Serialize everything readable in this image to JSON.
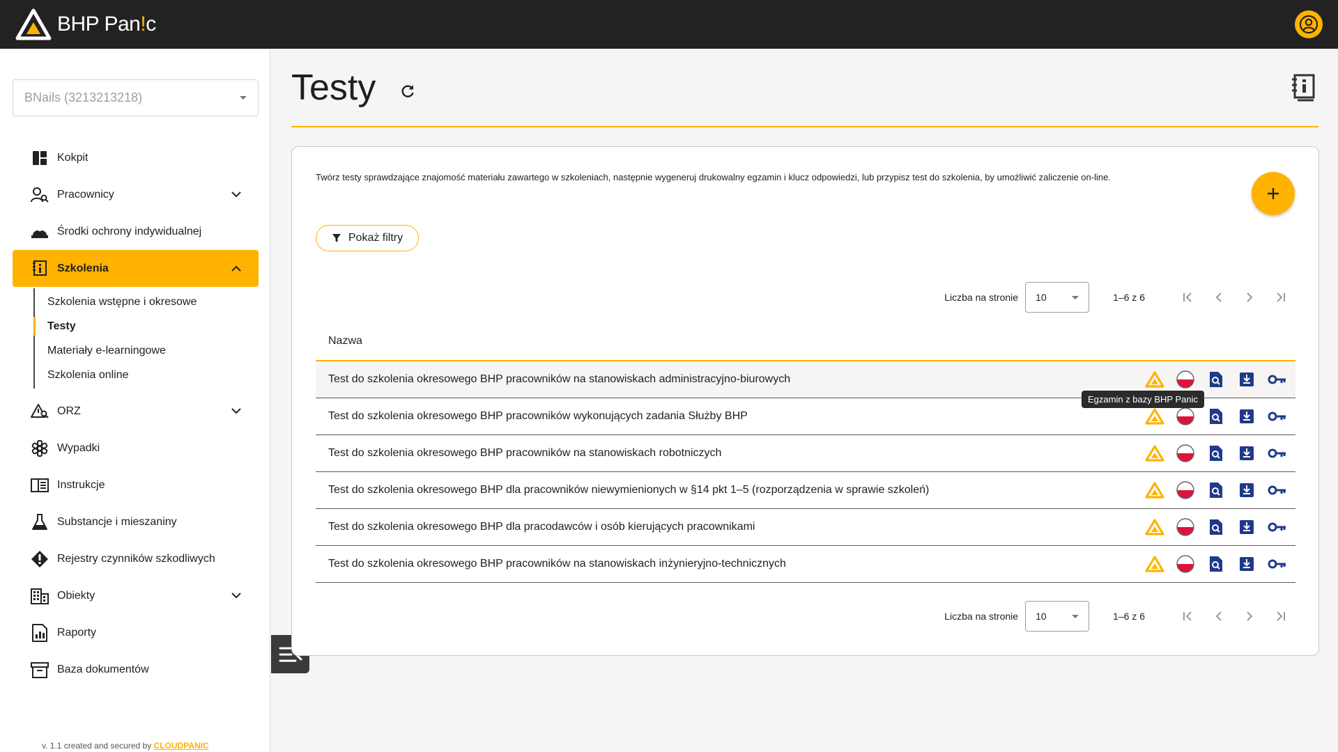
{
  "app": {
    "name_prefix": "BHP Pan",
    "name_dot": "!",
    "name_suffix": "c"
  },
  "sidebar": {
    "company_select": "BNails (3213213218)",
    "items": [
      {
        "label": "Kokpit",
        "icon": "dashboard-icon"
      },
      {
        "label": "Pracownicy",
        "icon": "users-search-icon",
        "expandable": true
      },
      {
        "label": "Środki ochrony indywidualnej",
        "icon": "helmet-icon"
      },
      {
        "label": "Szkolenia",
        "icon": "training-book-icon",
        "expandable": true,
        "active": true,
        "subitems": [
          {
            "label": "Szkolenia wstępne i okresowe"
          },
          {
            "label": "Testy",
            "active": true
          },
          {
            "label": "Materiały e-learningowe"
          },
          {
            "label": "Szkolenia online"
          }
        ]
      },
      {
        "label": "ORZ",
        "icon": "risk-search-icon",
        "expandable": true
      },
      {
        "label": "Wypadki",
        "icon": "medical-star-icon"
      },
      {
        "label": "Instrukcje",
        "icon": "book-open-icon"
      },
      {
        "label": "Substancje i mieszaniny",
        "icon": "flask-icon"
      },
      {
        "label": "Rejestry czynników szkodliwych",
        "icon": "warning-diamond-icon"
      },
      {
        "label": "Obiekty",
        "icon": "building-icon",
        "expandable": true
      },
      {
        "label": "Raporty",
        "icon": "report-icon"
      },
      {
        "label": "Baza dokumentów",
        "icon": "archive-icon"
      }
    ],
    "footer_prefix": "v. 1.1 created and secured by ",
    "footer_link": "CLOUDPANIC"
  },
  "page": {
    "title": "Testy",
    "description": "Twórz testy sprawdzające znajomość materiału zawartego w szkoleniach, następnie wygeneruj drukowalny egzamin i klucz odpowiedzi, lub przypisz test do szkolenia, by umożliwić zaliczenie on-line.",
    "filter_label": "Pokaż filtry"
  },
  "pager": {
    "per_page_label": "Liczba na stronie",
    "per_page_value": "10",
    "range": "1–6 z 6"
  },
  "table": {
    "column_name": "Nazwa",
    "rows": [
      "Test do szkolenia okresowego BHP pracowników na stanowiskach administracyjno-biurowych",
      "Test do szkolenia okresowego BHP pracowników wykonujących zadania Służby BHP",
      "Test do szkolenia okresowego BHP pracowników na stanowiskach robotniczych",
      "Test do szkolenia okresowego BHP dla pracowników niewymienionych w §14 pkt 1–5 (rozporządzenia w sprawie szkoleń)",
      "Test do szkolenia okresowego BHP dla pracodawców i osób kierujących pracownikami",
      "Test do szkolenia okresowego BHP pracowników na stanowiskach inżynieryjno-technicznych"
    ],
    "row_actions": [
      "bhp-panic-logo-icon",
      "poland-flag-icon",
      "preview-icon",
      "download-icon",
      "key-icon"
    ]
  },
  "tooltip": "Egzamin z bazy BHP Panic",
  "colors": {
    "accent": "#ffb300",
    "topbar": "#222222",
    "action_blue": "#1f3a8a",
    "flag_red": "#dc143c"
  }
}
